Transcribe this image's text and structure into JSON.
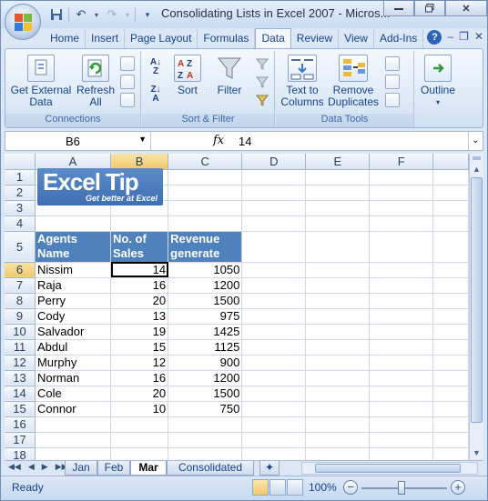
{
  "window": {
    "title": "Consolidating Lists in Excel 2007 - Micros..."
  },
  "ribbon_tabs": [
    "Home",
    "Insert",
    "Page Layout",
    "Formulas",
    "Data",
    "Review",
    "View",
    "Add-Ins"
  ],
  "active_tab": "Data",
  "ribbon": {
    "connections": {
      "label": "Connections",
      "get_external_data": "Get External\nData",
      "refresh_all": "Refresh\nAll"
    },
    "sort_filter": {
      "label": "Sort & Filter",
      "sort": "Sort",
      "filter": "Filter"
    },
    "data_tools": {
      "label": "Data Tools",
      "text_to_columns": "Text to\nColumns",
      "remove_duplicates": "Remove\nDuplicates"
    },
    "outline": {
      "label": "Outline"
    }
  },
  "formula_bar": {
    "name_box": "B6",
    "fx_label": "fx",
    "value": "14"
  },
  "columns": [
    "A",
    "B",
    "C",
    "D",
    "E",
    "F"
  ],
  "rows": [
    "1",
    "2",
    "3",
    "4",
    "5",
    "6",
    "7",
    "8",
    "9",
    "10",
    "11",
    "12",
    "13",
    "14",
    "15",
    "16",
    "17",
    "18"
  ],
  "logo": {
    "main": "Excel Tip",
    "tagline": "Get better at Excel"
  },
  "table": {
    "headers": [
      "Agents Name",
      "No. of Sales",
      "Revenue generate"
    ],
    "rows": [
      [
        "Nissim",
        "14",
        "1050"
      ],
      [
        "Raja",
        "16",
        "1200"
      ],
      [
        "Perry",
        "20",
        "1500"
      ],
      [
        "Cody",
        "13",
        "975"
      ],
      [
        "Salvador",
        "19",
        "1425"
      ],
      [
        "Abdul",
        "15",
        "1125"
      ],
      [
        "Murphy",
        "12",
        "900"
      ],
      [
        "Norman",
        "16",
        "1200"
      ],
      [
        "Cole",
        "20",
        "1500"
      ],
      [
        "Connor",
        "10",
        "750"
      ]
    ]
  },
  "sheet_tabs": [
    "Jan",
    "Feb",
    "Mar",
    "Consolidated"
  ],
  "active_sheet": "Mar",
  "status": {
    "ready": "Ready",
    "zoom": "100%"
  },
  "colors": {
    "header_fill": "#4f81bd",
    "ribbon_text": "#15428b"
  }
}
